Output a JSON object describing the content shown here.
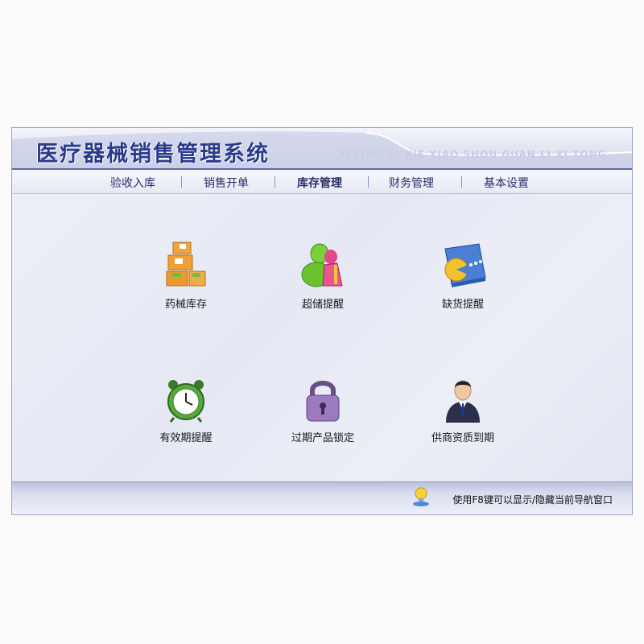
{
  "app": {
    "title": "医疗器械销售管理系统",
    "subtitle": "YI LIAO QI XIE XIAO SHOU GUAN LI XI TONG"
  },
  "menu": {
    "items": [
      {
        "label": "验收入库"
      },
      {
        "label": "销售开单"
      },
      {
        "label": "库存管理",
        "active": true
      },
      {
        "label": "财务管理"
      },
      {
        "label": "基本设置"
      }
    ]
  },
  "launchers": [
    {
      "label": "药械库存",
      "icon": "boxes-icon"
    },
    {
      "label": "超储提醒",
      "icon": "msn-user-icon"
    },
    {
      "label": "缺货提醒",
      "icon": "book-pacman-icon"
    },
    {
      "label": "有效期提醒",
      "icon": "alarm-clock-icon"
    },
    {
      "label": "过期产品锁定",
      "icon": "padlock-icon"
    },
    {
      "label": "供商资质到期",
      "icon": "businessman-icon"
    }
  ],
  "status": {
    "text": "使用F8键可以显示/隐藏当前导航窗口",
    "icon": "lamp-icon"
  },
  "colors": {
    "title": "#2a3a8c",
    "menu_border": "#5d69a8",
    "background": "#e8eaf5"
  }
}
